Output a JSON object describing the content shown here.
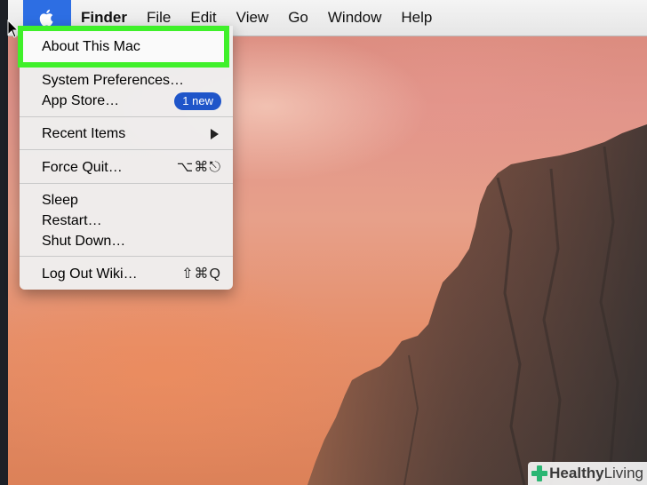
{
  "menubar": {
    "apple_icon": "apple-icon",
    "items": [
      {
        "label": "Finder",
        "bold": true
      },
      {
        "label": "File"
      },
      {
        "label": "Edit"
      },
      {
        "label": "View"
      },
      {
        "label": "Go"
      },
      {
        "label": "Window"
      },
      {
        "label": "Help"
      }
    ]
  },
  "apple_menu": {
    "about": "About This Mac",
    "system_preferences": "System Preferences…",
    "app_store": "App Store…",
    "app_store_badge": "1 new",
    "recent_items": "Recent Items",
    "force_quit": "Force Quit…",
    "force_quit_shortcut": "⌥⌘⎋",
    "sleep": "Sleep",
    "restart": "Restart…",
    "shut_down": "Shut Down…",
    "log_out": "Log Out Wiki…",
    "log_out_shortcut": "⇧⌘Q"
  },
  "watermark": {
    "brand_bold": "Healthy",
    "brand_regular": " Living"
  },
  "colors": {
    "highlight": "#3ff02a",
    "apple_menu_active": "#2d6ee3",
    "badge": "#1f55c9",
    "watermark_cross": "#2bb673"
  }
}
